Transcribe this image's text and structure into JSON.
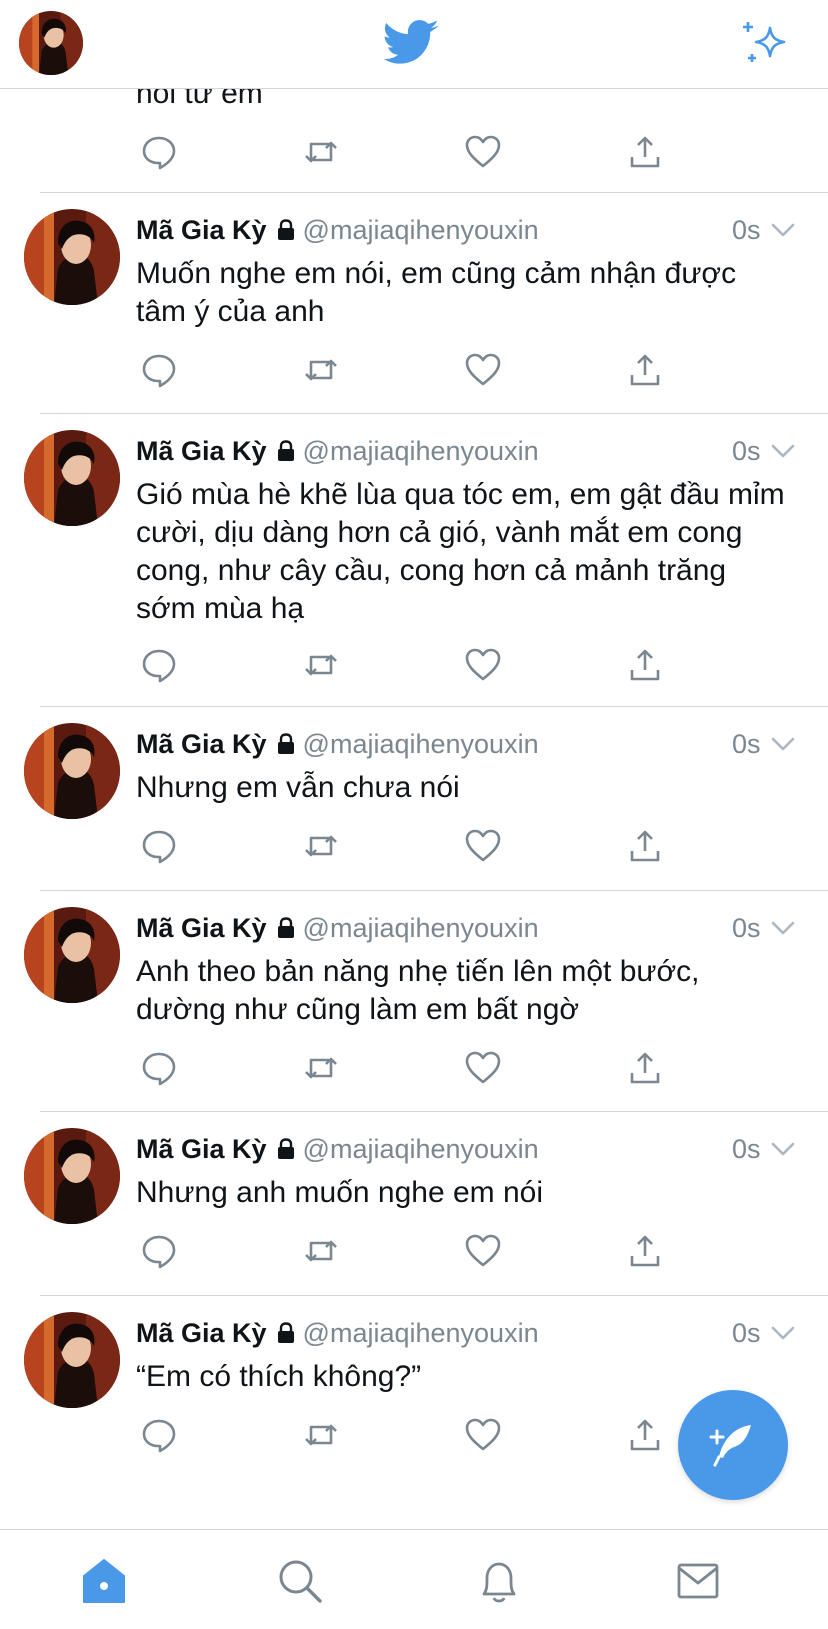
{
  "header": {
    "profile_icon": "avatar",
    "logo_icon": "twitter-bird-icon",
    "timeline_icon": "sparkle-icon",
    "accent_color": "#4a99e9"
  },
  "feed": {
    "partial_tweet_text": "nói từ em",
    "tweets": [
      {
        "name": "Mã Gia Kỳ",
        "handle": "@majiaqihenyouxin",
        "time": "0s",
        "text": "Muốn nghe em nói, em cũng cảm nhận được tâm ý của anh"
      },
      {
        "name": "Mã Gia Kỳ",
        "handle": "@majiaqihenyouxin",
        "time": "0s",
        "text": "Gió mùa hè khẽ lùa qua tóc em, em gật đầu mỉm cười, dịu dàng hơn cả gió, vành mắt em cong cong, như cây cầu, cong hơn cả mảnh trăng sớm mùa hạ"
      },
      {
        "name": "Mã Gia Kỳ",
        "handle": "@majiaqihenyouxin",
        "time": "0s",
        "text": "Nhưng em vẫn chưa nói"
      },
      {
        "name": "Mã Gia Kỳ",
        "handle": "@majiaqihenyouxin",
        "time": "0s",
        "text": "Anh theo bản năng nhẹ tiến lên một bước, dường như cũng làm em bất ngờ"
      },
      {
        "name": "Mã Gia Kỳ",
        "handle": "@majiaqihenyouxin",
        "time": "0s",
        "text": "Nhưng anh muốn nghe em nói"
      },
      {
        "name": "Mã Gia Kỳ",
        "handle": "@majiaqihenyouxin",
        "time": "0s",
        "text": "“Em có thích không?”"
      }
    ]
  },
  "fab": {
    "icon": "compose-tweet-icon"
  },
  "bottom_nav": {
    "items": [
      {
        "icon": "home-icon",
        "active": true
      },
      {
        "icon": "search-icon",
        "active": false
      },
      {
        "icon": "bell-icon",
        "active": false
      },
      {
        "icon": "mail-icon",
        "active": false
      }
    ]
  }
}
